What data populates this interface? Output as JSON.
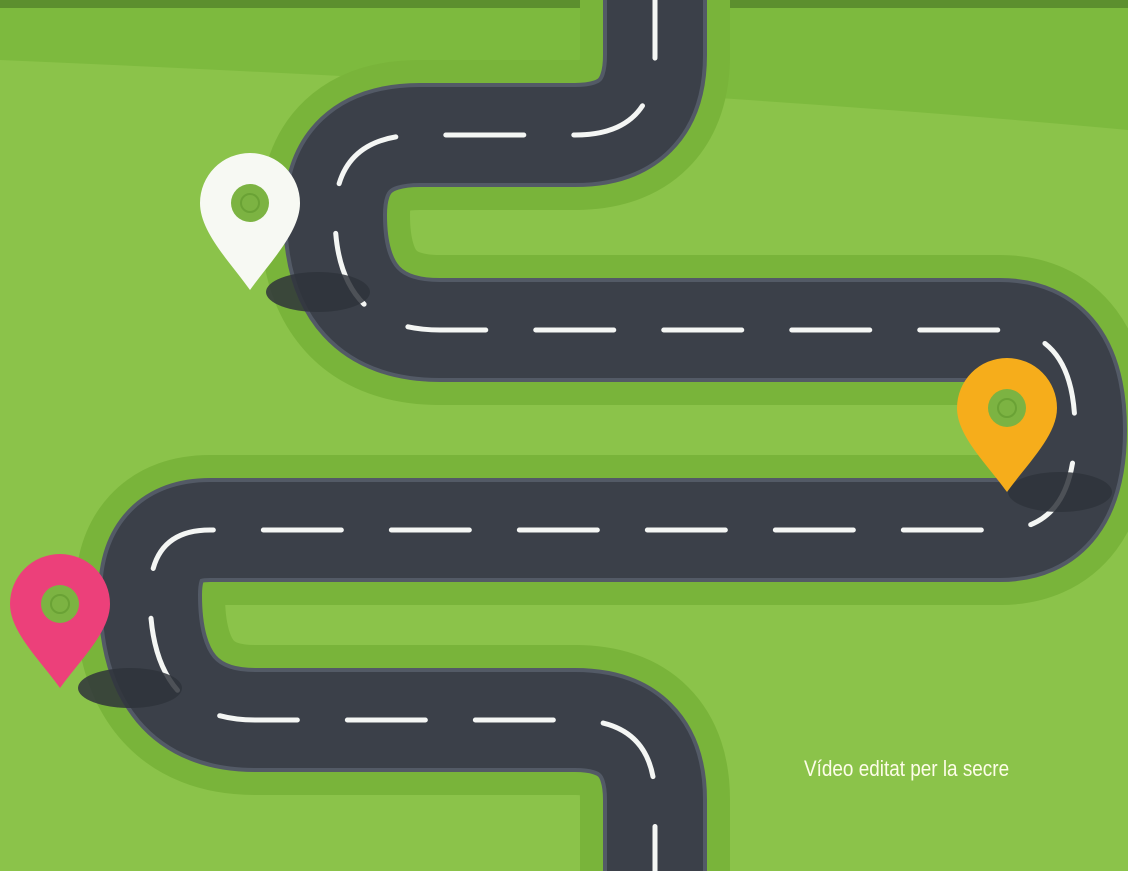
{
  "scene": {
    "description_icons": [
      "pin-icon-white",
      "pin-icon-orange",
      "pin-icon-pink"
    ],
    "colors": {
      "grass": "#8bc34a",
      "grass_light": "#7dba3e",
      "road_border": "#4b5563",
      "road": "#3b4049",
      "lane_marking": "#f4f6f4",
      "pin_white": "#f7f9f3",
      "pin_orange": "#f6ad1b",
      "pin_pink": "#ec407a",
      "caption_text": "#fdfde8"
    }
  },
  "caption": {
    "text": "Vídeo editat per la secre"
  }
}
